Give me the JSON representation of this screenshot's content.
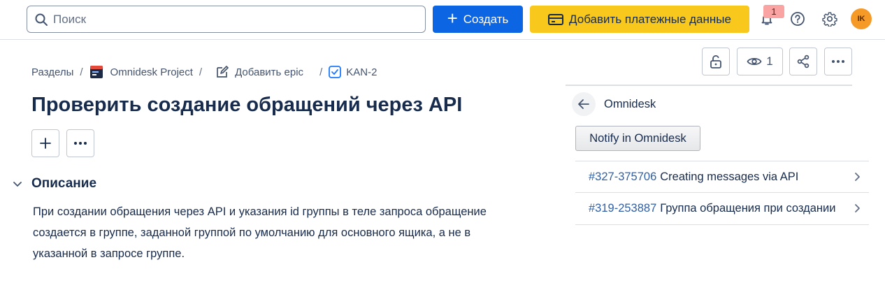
{
  "topbar": {
    "search_placeholder": "Поиск",
    "create_label": "Создать",
    "pay_label": "Добавить платежные данные",
    "notification_count": "1",
    "avatar_initials": "IK"
  },
  "breadcrumb": {
    "root": "Разделы",
    "project": "Omnidesk Project",
    "epic": "Добавить epic",
    "issue": "KAN-2"
  },
  "issue": {
    "title": "Проверить создание обращений через API",
    "description_heading": "Описание",
    "description": "При создании обращения через API и указания id группы в теле запроса обращение создается в группе, заданной группой по умолчанию для основного ящика, а не в указанной в запросе группе."
  },
  "actions": {
    "watch_count": "1"
  },
  "panel": {
    "title": "Omnidesk",
    "notify_label": "Notify in Omnidesk",
    "items": [
      {
        "id": "#327-375706",
        "text": "Creating messages via API"
      },
      {
        "id": "#319-253887",
        "text": "Группа обращения при создании"
      }
    ]
  },
  "colors": {
    "primary": "#0c66e4",
    "warning": "#f8c81c",
    "avatar": "#f59a27",
    "badge": "#f9a3a3",
    "link": "#2f5fa5"
  }
}
